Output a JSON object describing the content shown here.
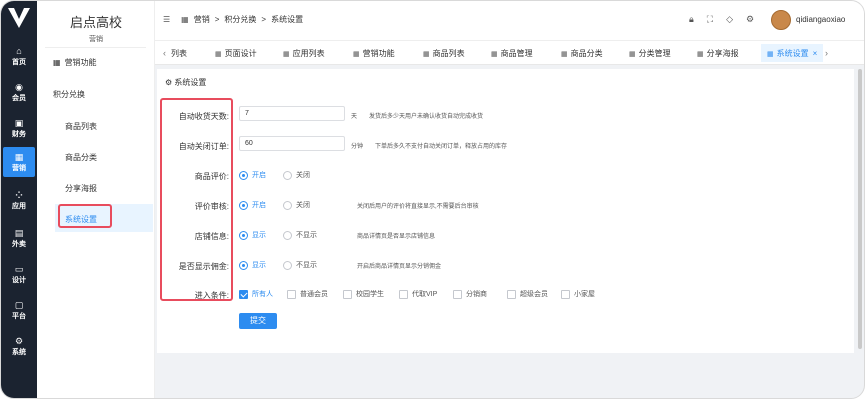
{
  "sidebar_brand": {
    "title": "启点高校",
    "subtitle": "营销"
  },
  "nav": [
    {
      "label": "首页",
      "icon": "home-icon",
      "glyph": "⌂"
    },
    {
      "label": "会员",
      "icon": "member-icon",
      "glyph": "◉"
    },
    {
      "label": "财务",
      "icon": "finance-icon",
      "glyph": "▣"
    },
    {
      "label": "营销",
      "icon": "marketing-icon",
      "glyph": "▦"
    },
    {
      "label": "应用",
      "icon": "apps-icon",
      "glyph": "⁘"
    },
    {
      "label": "外卖",
      "icon": "takeout-icon",
      "glyph": "▤"
    },
    {
      "label": "设计",
      "icon": "design-icon",
      "glyph": "▭"
    },
    {
      "label": "平台",
      "icon": "platform-icon",
      "glyph": "▢"
    },
    {
      "label": "系统",
      "icon": "system-icon",
      "glyph": "⚙"
    }
  ],
  "submenu": {
    "marketing_features": "营销功能",
    "points_exchange": "积分兑换",
    "items": [
      "商品列表",
      "商品分类",
      "分享海报",
      "系统设置"
    ]
  },
  "header": {
    "breadcrumb": [
      "营销",
      "积分兑换",
      "系统设置"
    ],
    "username": "qidiangaoxiao"
  },
  "tabs": [
    "列表",
    "页面设计",
    "应用列表",
    "营销功能",
    "商品列表",
    "商品管理",
    "商品分类",
    "分类管理",
    "分享海报",
    "系统设置"
  ],
  "form": {
    "section_title": "系统设置",
    "auto_receive": {
      "label": "自动收货天数:",
      "value": "7",
      "unit": "天",
      "hint": "发货后多少天用户未确认收货自动完成收货"
    },
    "auto_close": {
      "label": "自动关闭订单:",
      "value": "60",
      "unit": "分钟",
      "hint": "下单后多久不支付自动关闭订单，释放占用的库存"
    },
    "review": {
      "label": "商品评价:",
      "on": "开启",
      "off": "关闭"
    },
    "review_audit": {
      "label": "评价审核:",
      "on": "开启",
      "off": "关闭",
      "hint": "关闭后用户的评价将直接显示,不需要后台审核"
    },
    "store_info": {
      "label": "店铺信息:",
      "on": "显示",
      "off": "不显示",
      "hint": "商品详情页是否显示店铺信息"
    },
    "commission": {
      "label": "是否显示佣金:",
      "on": "显示",
      "off": "不显示",
      "hint": "开启后商品详情页显示分销佣金"
    },
    "entry": {
      "label": "进入条件:",
      "options": [
        "所有人",
        "普通会员",
        "校园学生",
        "代取VIP",
        "分销商",
        "超级会员",
        "小家屋"
      ],
      "checked": [
        0
      ]
    },
    "submit_label": "提交"
  },
  "colors": {
    "accent": "#2d8cf0",
    "highlight_border": "#e84c5d",
    "leftbar_bg": "#1b2330"
  }
}
